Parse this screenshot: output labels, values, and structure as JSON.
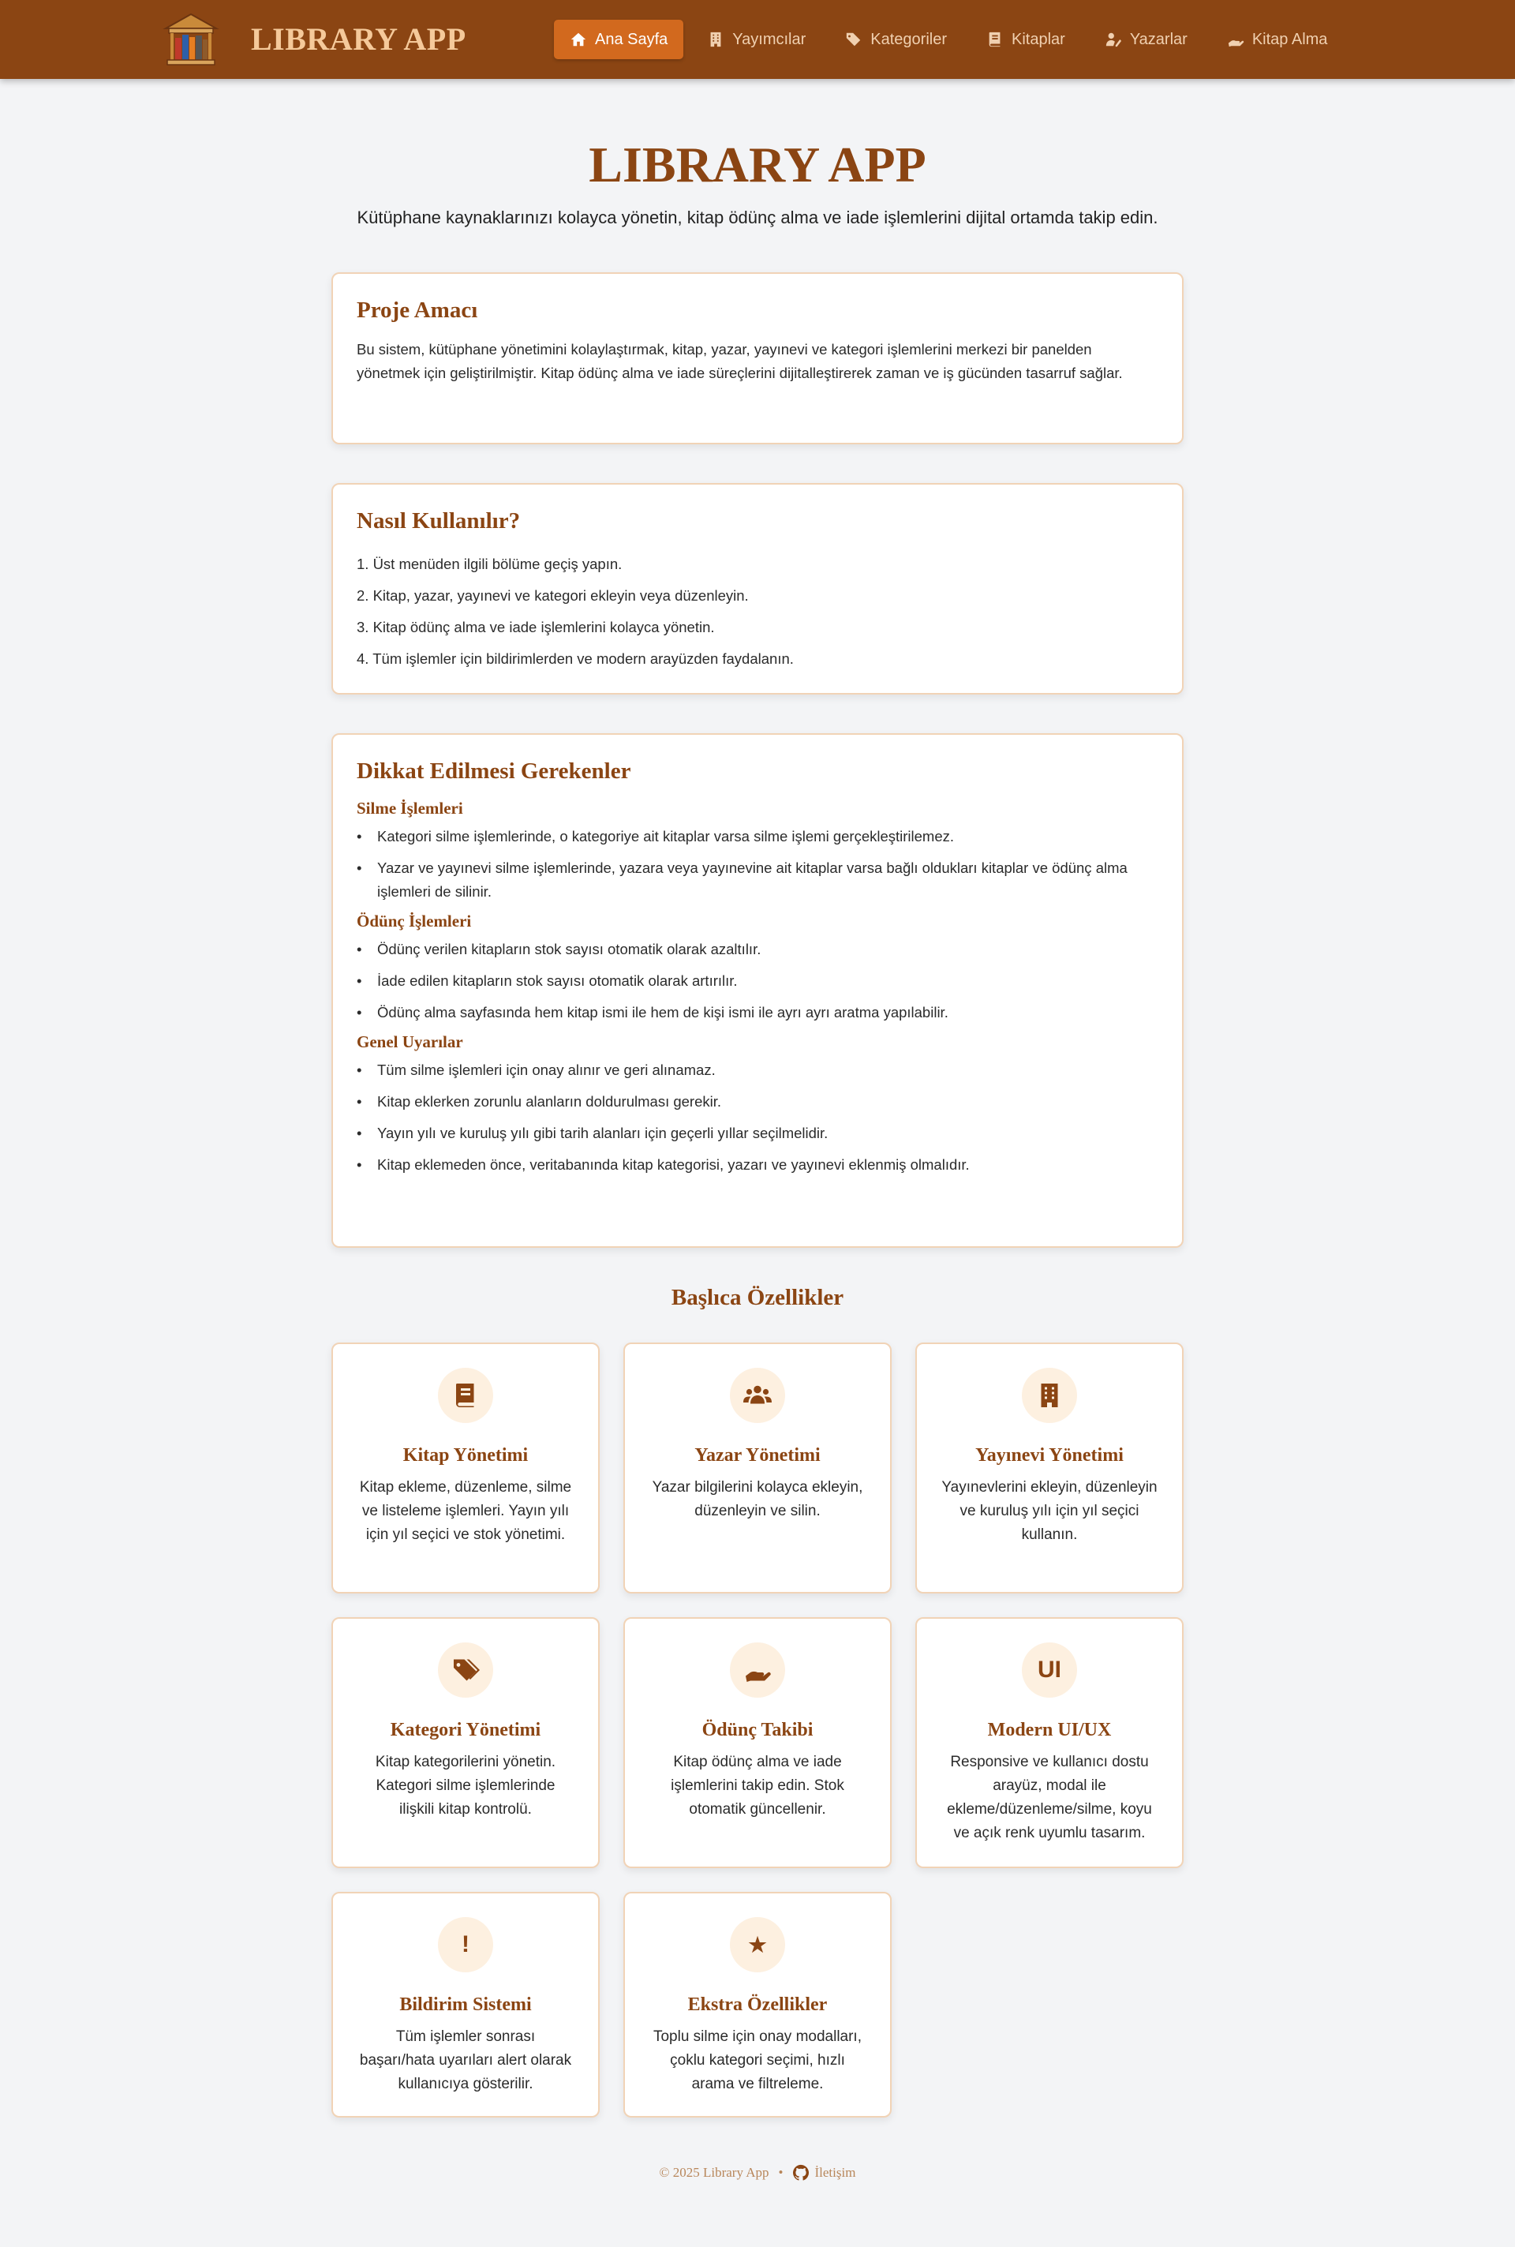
{
  "navbar": {
    "brand": "LIBRARY APP",
    "items": [
      {
        "label": "Ana Sayfa",
        "icon": "home-icon",
        "active": true
      },
      {
        "label": "Yayımcılar",
        "icon": "building-icon",
        "active": false
      },
      {
        "label": "Kategoriler",
        "icon": "tags-icon",
        "active": false
      },
      {
        "label": "Kitaplar",
        "icon": "book-icon",
        "active": false
      },
      {
        "label": "Yazarlar",
        "icon": "user-pen-icon",
        "active": false
      },
      {
        "label": "Kitap Alma",
        "icon": "hand-holding-icon",
        "active": false
      }
    ]
  },
  "hero": {
    "title": "LIBRARY APP",
    "subtitle": "Kütüphane kaynaklarınızı kolayca yönetin, kitap ödünç alma ve iade işlemlerini dijital ortamda takip edin."
  },
  "purpose": {
    "title": "Proje Amacı",
    "text": "Bu sistem, kütüphane yönetimini kolaylaştırmak, kitap, yazar, yayınevi ve kategori işlemlerini merkezi bir panelden yönetmek için geliştirilmiştir. Kitap ödünç alma ve iade süreçlerini dijitalleştirerek zaman ve iş gücünden tasarruf sağlar."
  },
  "howto": {
    "title": "Nasıl Kullanılır?",
    "steps": [
      "1. Üst menüden ilgili bölüme geçiş yapın.",
      "2. Kitap, yazar, yayınevi ve kategori ekleyin veya düzenleyin.",
      "3. Kitap ödünç alma ve iade işlemlerini kolayca yönetin.",
      "4. Tüm işlemler için bildirimlerden ve modern arayüzden faydalanın."
    ]
  },
  "notes": {
    "title": "Dikkat Edilmesi Gerekenler",
    "delete_title": "Silme İşlemleri",
    "delete_items": [
      "Kategori silme işlemlerinde, o kategoriye ait kitaplar varsa silme işlemi gerçekleştirilemez.",
      "Yazar ve yayınevi silme işlemlerinde, yazara veya yayınevine ait kitaplar varsa bağlı oldukları kitaplar ve ödünç alma işlemleri de silinir."
    ],
    "loan_title": "Ödünç İşlemleri",
    "loan_items": [
      "Ödünç verilen kitapların stok sayısı otomatik olarak azaltılır.",
      "İade edilen kitapların stok sayısı otomatik olarak artırılır.",
      "Ödünç alma sayfasında hem kitap ismi ile hem de kişi ismi ile ayrı ayrı aratma yapılabilir."
    ],
    "general_title": "Genel Uyarılar",
    "general_items": [
      "Tüm silme işlemleri için onay alınır ve geri alınamaz.",
      "Kitap eklerken zorunlu alanların doldurulması gerekir.",
      "Yayın yılı ve kuruluş yılı gibi tarih alanları için geçerli yıllar seçilmelidir.",
      "Kitap eklemeden önce, veritabanında kitap kategorisi, yazarı ve yayınevi eklenmiş olmalıdır."
    ]
  },
  "features": {
    "title": "Başlıca Özellikler",
    "items": [
      {
        "title": "Kitap Yönetimi",
        "text": "Kitap ekleme, düzenleme, silme ve listeleme işlemleri. Yayın yılı için yıl seçici ve stok yönetimi.",
        "icon": "book-icon"
      },
      {
        "title": "Yazar Yönetimi",
        "text": "Yazar bilgilerini kolayca ekleyin, düzenleyin ve silin.",
        "icon": "users-icon"
      },
      {
        "title": "Yayınevi Yönetimi",
        "text": "Yayınevlerini ekleyin, düzenleyin ve kuruluş yılı için yıl seçici kullanın.",
        "icon": "building-icon"
      },
      {
        "title": "Kategori Yönetimi",
        "text": "Kitap kategorilerini yönetin. Kategori silme işlemlerinde ilişkili kitap kontrolü.",
        "icon": "tags-icon"
      },
      {
        "title": "Ödünç Takibi",
        "text": "Kitap ödünç alma ve iade işlemlerini takip edin. Stok otomatik güncellenir.",
        "icon": "hand-holding-icon"
      },
      {
        "title": "Modern UI/UX",
        "text": "Responsive ve kullanıcı dostu arayüz, modal ile ekleme/düzenleme/silme, koyu ve açık renk uyumlu tasarım.",
        "icon": "ui-icon",
        "glyph": "UI"
      },
      {
        "title": "Bildirim Sistemi",
        "text": "Tüm işlemler sonrası başarı/hata uyarıları alert olarak kullanıcıya gösterilir.",
        "icon": "exclamation-icon",
        "glyph": "!"
      },
      {
        "title": "Ekstra Özellikler",
        "text": "Toplu silme için onay modalları, çoklu kategori seçimi, hızlı arama ve filtreleme.",
        "icon": "star-icon",
        "glyph": "★"
      }
    ]
  },
  "footer": {
    "copyright": "© 2025 Library App",
    "separator": "•",
    "contact": "İletişim"
  },
  "colors": {
    "navbar": "#8b4513",
    "accent": "#d2691e",
    "heading": "#8b4513",
    "background": "#f3f4f6"
  }
}
